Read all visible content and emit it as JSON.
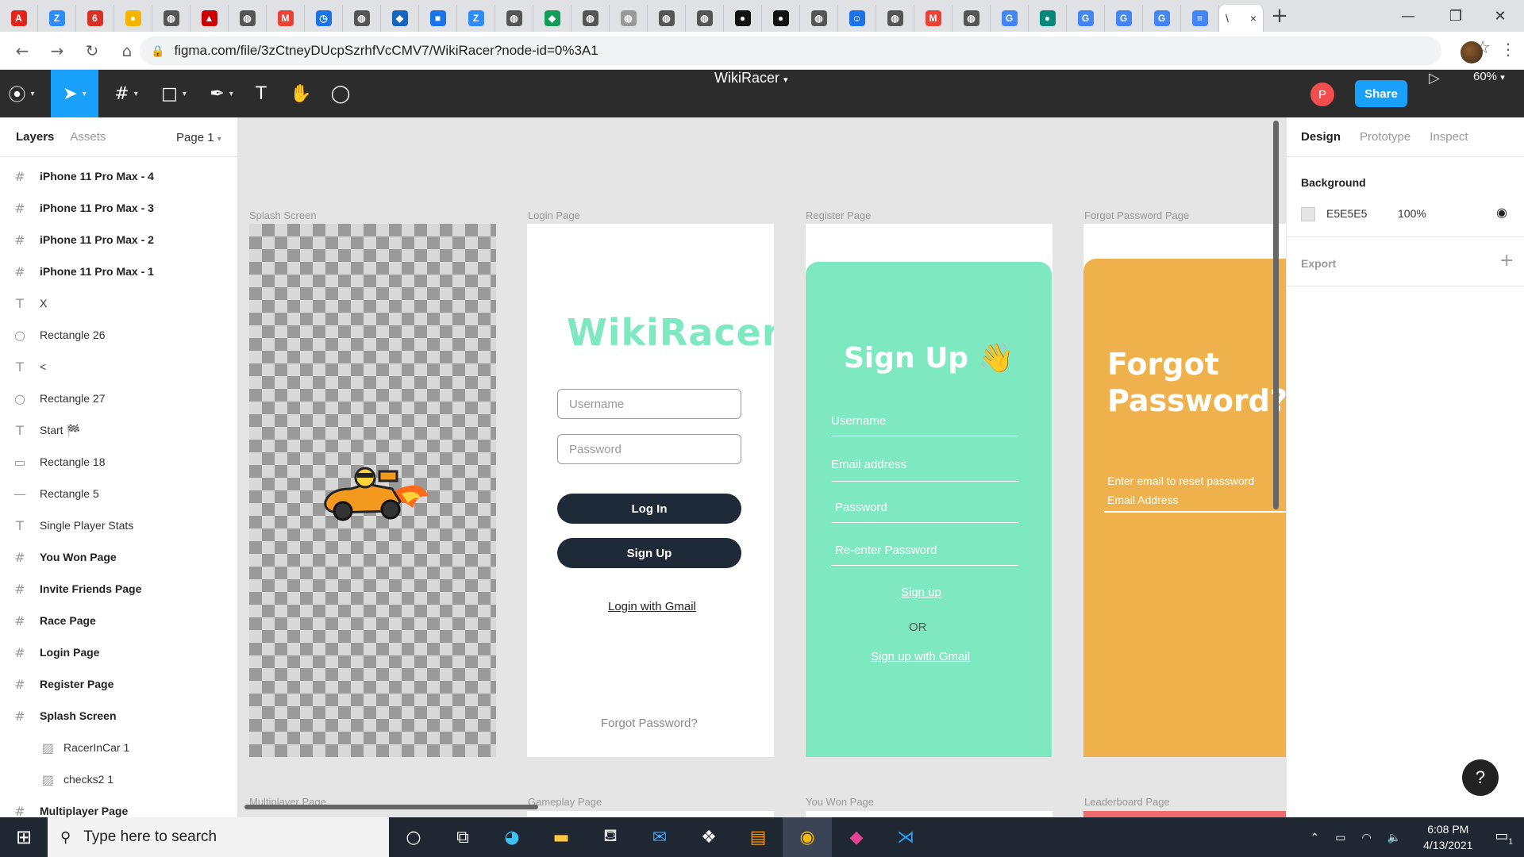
{
  "browser": {
    "tabs": [
      {
        "icon": "acrobat-icon",
        "color": "#e1251b",
        "glyph": "A"
      },
      {
        "icon": "zoom-icon",
        "color": "#2d8cff",
        "glyph": "Z"
      },
      {
        "icon": "calendar-icon",
        "color": "#d93025",
        "glyph": "6"
      },
      {
        "icon": "chrome-web-icon",
        "color": "#f4b400",
        "glyph": "●"
      },
      {
        "icon": "globe-icon",
        "color": "#555",
        "glyph": "◍"
      },
      {
        "icon": "flag-icon",
        "color": "#c00",
        "glyph": "▲"
      },
      {
        "icon": "globe-icon",
        "color": "#555",
        "glyph": "◍"
      },
      {
        "icon": "gmail-icon",
        "color": "#ea4335",
        "glyph": "M"
      },
      {
        "icon": "clock-icon",
        "color": "#1a73e8",
        "glyph": "◷"
      },
      {
        "icon": "globe-icon",
        "color": "#555",
        "glyph": "◍"
      },
      {
        "icon": "drop-icon",
        "color": "#1565c0",
        "glyph": "◆"
      },
      {
        "icon": "bookmark-icon",
        "color": "#1a73e8",
        "glyph": "■"
      },
      {
        "icon": "zoom-icon",
        "color": "#2d8cff",
        "glyph": "Z"
      },
      {
        "icon": "globe-icon",
        "color": "#555",
        "glyph": "◍"
      },
      {
        "icon": "diamond-icon",
        "color": "#0f9d58",
        "glyph": "◆"
      },
      {
        "icon": "globe-icon",
        "color": "#555",
        "glyph": "◍"
      },
      {
        "icon": "globe-icon",
        "color": "#999",
        "glyph": "◍"
      },
      {
        "icon": "globe-icon",
        "color": "#555",
        "glyph": "◍"
      },
      {
        "icon": "globe-icon",
        "color": "#555",
        "glyph": "◍"
      },
      {
        "icon": "github-icon",
        "color": "#111",
        "glyph": "●"
      },
      {
        "icon": "github-icon",
        "color": "#111",
        "glyph": "●"
      },
      {
        "icon": "globe-icon",
        "color": "#555",
        "glyph": "◍"
      },
      {
        "icon": "robot-icon",
        "color": "#1a73e8",
        "glyph": "☺"
      },
      {
        "icon": "globe-icon",
        "color": "#555",
        "glyph": "◍"
      },
      {
        "icon": "gmail-icon",
        "color": "#ea4335",
        "glyph": "M"
      },
      {
        "icon": "globe-icon",
        "color": "#555",
        "glyph": "◍"
      },
      {
        "icon": "google-icon",
        "color": "#4285f4",
        "glyph": "G"
      },
      {
        "icon": "meet-icon",
        "color": "#00897b",
        "glyph": "●"
      },
      {
        "icon": "google-icon",
        "color": "#4285f4",
        "glyph": "G"
      },
      {
        "icon": "google-icon",
        "color": "#4285f4",
        "glyph": "G"
      },
      {
        "icon": "google-icon",
        "color": "#4285f4",
        "glyph": "G"
      },
      {
        "icon": "docs-icon",
        "color": "#4285f4",
        "glyph": "≡"
      }
    ],
    "active_tab": {
      "title": "\\",
      "close": "×"
    },
    "new_tab": "+",
    "url": "figma.com/file/3zCtneyDUcpSzrhfVcCMV7/WikiRacer?node-id=0%3A1"
  },
  "figma": {
    "file_name": "WikiRacer",
    "avatar_initial": "P",
    "share_label": "Share",
    "zoom_level": "60%",
    "left_tabs": {
      "layers": "Layers",
      "assets": "Assets",
      "page": "Page 1"
    },
    "layers": [
      {
        "type": "frame",
        "name": "iPhone 11 Pro Max - 4"
      },
      {
        "type": "frame",
        "name": "iPhone 11 Pro Max - 3"
      },
      {
        "type": "frame",
        "name": "iPhone 11 Pro Max - 2"
      },
      {
        "type": "frame",
        "name": "iPhone 11 Pro Max - 1"
      },
      {
        "type": "text",
        "name": "X"
      },
      {
        "type": "ellipse",
        "name": "Rectangle 26"
      },
      {
        "type": "text",
        "name": "<"
      },
      {
        "type": "ellipse",
        "name": "Rectangle 27"
      },
      {
        "type": "text",
        "name": "Start 🏁"
      },
      {
        "type": "rect",
        "name": "Rectangle 18"
      },
      {
        "type": "line",
        "name": "Rectangle 5"
      },
      {
        "type": "text",
        "name": "Single Player Stats"
      },
      {
        "type": "frame",
        "name": "You Won Page"
      },
      {
        "type": "frame",
        "name": "Invite Friends Page"
      },
      {
        "type": "frame",
        "name": "Race Page"
      },
      {
        "type": "frame",
        "name": "Login Page"
      },
      {
        "type": "frame",
        "name": "Register Page"
      },
      {
        "type": "frame",
        "name": "Splash Screen"
      },
      {
        "type": "image",
        "name": "RacerInCar 1"
      },
      {
        "type": "image",
        "name": "checks2 1"
      },
      {
        "type": "frame",
        "name": "Multiplayer Page"
      }
    ],
    "canvas": {
      "frames_row1": [
        "Splash Screen",
        "Login Page",
        "Register Page",
        "Forgot Password Page"
      ],
      "frames_row2": [
        "Multiplayer Page",
        "Gameplay Page",
        "You Won Page",
        "Leaderboard Page"
      ],
      "login": {
        "title": "WikiRacer",
        "username_placeholder": "Username",
        "password_placeholder": "Password",
        "login_btn": "Log In",
        "signup_btn": "Sign Up",
        "gmail_link": "Login with Gmail",
        "forgot_link": "Forgot Password?"
      },
      "register": {
        "title": "Sign Up 👋",
        "fields": [
          "Username",
          "Email address",
          "Password",
          "Re-enter Password"
        ],
        "signup_link": "Sign up",
        "or": "OR",
        "gmail_link": "Sign up with Gmail"
      },
      "forgot": {
        "title_line1": "Forgot",
        "title_line2": "Password?",
        "hint": "Enter email to reset password",
        "field": "Email Address"
      }
    },
    "right_tabs": {
      "design": "Design",
      "prototype": "Prototype",
      "inspect": "Inspect"
    },
    "background_label": "Background",
    "background_hex": "E5E5E5",
    "background_opacity": "100%",
    "export_label": "Export",
    "help": "?"
  },
  "taskbar": {
    "search_placeholder": "Type here to search",
    "time": "6:08 PM",
    "date": "4/13/2021",
    "notif_count": "1"
  }
}
